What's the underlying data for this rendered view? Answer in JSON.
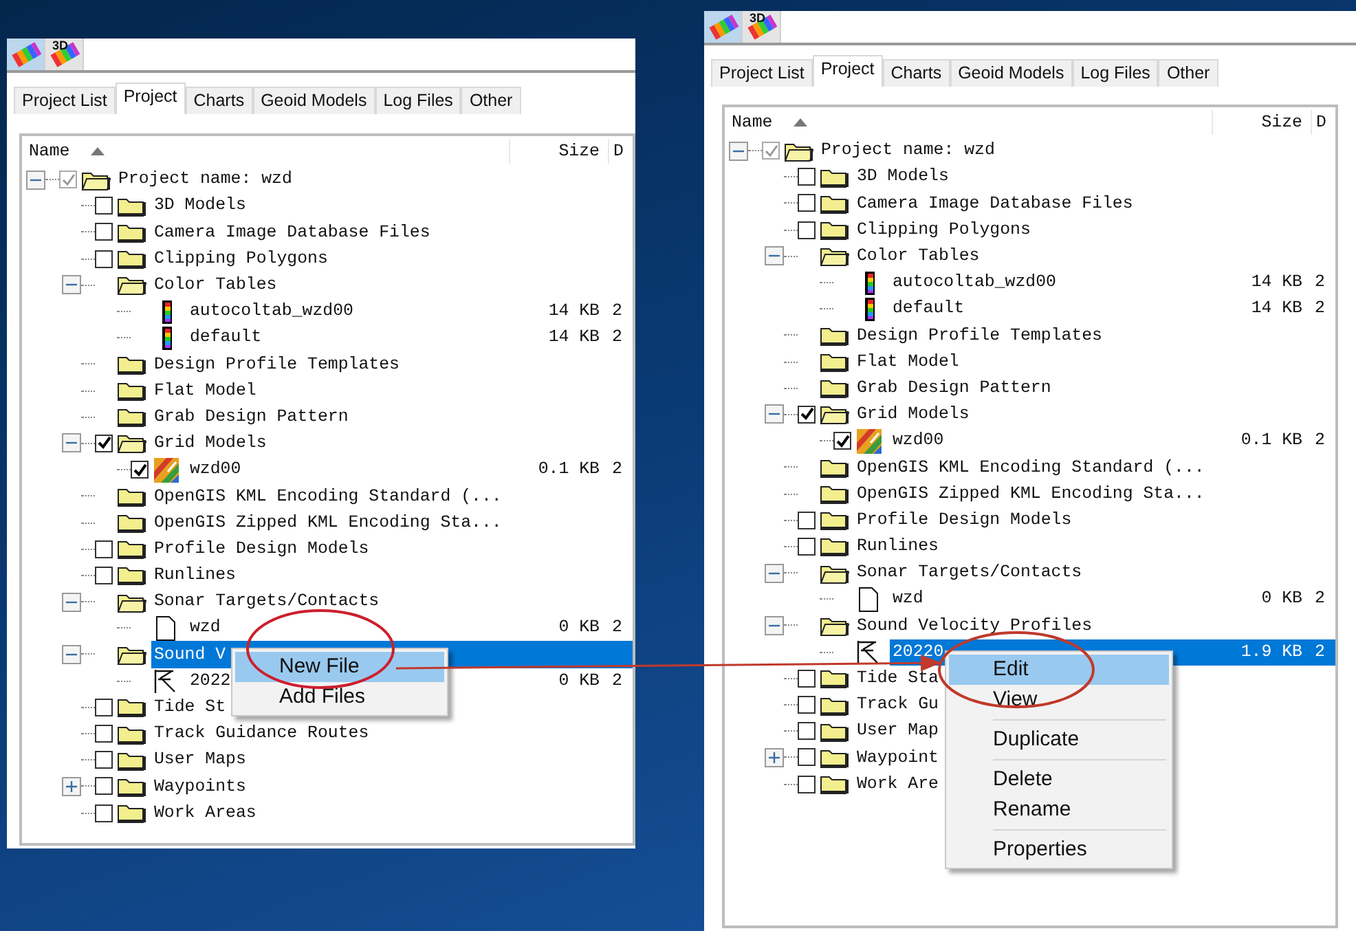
{
  "panels": [
    {
      "toolbar": [
        {
          "selected": true
        },
        {
          "selected": false,
          "label": "3D"
        }
      ],
      "tabs": [
        {
          "label": "Project List",
          "selected": false
        },
        {
          "label": "Project",
          "selected": true
        },
        {
          "label": "Charts",
          "selected": false
        },
        {
          "label": "Geoid Models",
          "selected": false
        },
        {
          "label": "Log Files",
          "selected": false
        },
        {
          "label": "Other",
          "selected": false
        }
      ],
      "columns": [
        {
          "label": "Name",
          "sort_ascending": true
        },
        {
          "label": "Size"
        },
        {
          "label": "D"
        }
      ],
      "tree": [
        {
          "label": "Project name: wzd",
          "kind": "folder",
          "expanded": true,
          "checked": true,
          "dimmed": true,
          "children": [
            {
              "label": "3D Models",
              "kind": "folder",
              "checked": false
            },
            {
              "label": "Camera Image Database Files",
              "kind": "folder",
              "checked": false
            },
            {
              "label": "Clipping Polygons",
              "kind": "folder",
              "checked": false
            },
            {
              "label": "Color Tables",
              "kind": "folder",
              "expanded": true,
              "children": [
                {
                  "label": "autocoltab_wzd00",
                  "kind": "colortable",
                  "size": "14 KB",
                  "date": "2"
                },
                {
                  "label": "default",
                  "kind": "colortable",
                  "size": "14 KB",
                  "date": "2"
                }
              ]
            },
            {
              "label": "Design Profile Templates",
              "kind": "folder"
            },
            {
              "label": "Flat Model",
              "kind": "folder"
            },
            {
              "label": "Grab Design Pattern",
              "kind": "folder"
            },
            {
              "label": "Grid Models",
              "kind": "folder",
              "expanded": true,
              "checked": true,
              "children": [
                {
                  "label": "wzd00",
                  "kind": "grid",
                  "checked": true,
                  "size": "0.1 KB",
                  "date": "2"
                }
              ]
            },
            {
              "label": "OpenGIS KML Encoding Standard (...",
              "kind": "folder"
            },
            {
              "label": "OpenGIS Zipped KML Encoding Sta...",
              "kind": "folder"
            },
            {
              "label": "Profile Design Models",
              "kind": "folder",
              "checked": false
            },
            {
              "label": "Runlines",
              "kind": "folder",
              "checked": false
            },
            {
              "label": "Sonar Targets/Contacts",
              "kind": "folder",
              "expanded": true,
              "children": [
                {
                  "label": "wzd",
                  "kind": "file",
                  "size": "0 KB",
                  "date": "2"
                }
              ]
            },
            {
              "label": "Sound V",
              "kind": "folder",
              "expanded": true,
              "selected": true,
              "children": [
                {
                  "label": "2022",
                  "kind": "profile",
                  "size": "0 KB",
                  "date": "2"
                }
              ]
            },
            {
              "label": "Tide St",
              "kind": "folder",
              "checked": false
            },
            {
              "label": "Track Guidance Routes",
              "kind": "folder",
              "checked": false
            },
            {
              "label": "User Maps",
              "kind": "folder",
              "checked": false
            },
            {
              "label": "Waypoints",
              "kind": "folder",
              "expanded": false,
              "checked": false
            },
            {
              "label": "Work Areas",
              "kind": "folder",
              "checked": false
            }
          ]
        }
      ],
      "context_menu": {
        "groups": [
          [
            {
              "label": "New File",
              "highlighted": true
            },
            {
              "label": "Add Files",
              "highlighted": false
            }
          ]
        ]
      }
    },
    {
      "toolbar": [
        {
          "selected": true
        },
        {
          "selected": false,
          "label": "3D"
        }
      ],
      "tabs": [
        {
          "label": "Project List",
          "selected": false
        },
        {
          "label": "Project",
          "selected": true
        },
        {
          "label": "Charts",
          "selected": false
        },
        {
          "label": "Geoid Models",
          "selected": false
        },
        {
          "label": "Log Files",
          "selected": false
        },
        {
          "label": "Other",
          "selected": false
        }
      ],
      "columns": [
        {
          "label": "Name",
          "sort_ascending": true
        },
        {
          "label": "Size"
        },
        {
          "label": "D"
        }
      ],
      "tree": [
        {
          "label": "Project name: wzd",
          "kind": "folder",
          "expanded": true,
          "checked": true,
          "dimmed": true,
          "children": [
            {
              "label": "3D Models",
              "kind": "folder",
              "checked": false
            },
            {
              "label": "Camera Image Database Files",
              "kind": "folder",
              "checked": false
            },
            {
              "label": "Clipping Polygons",
              "kind": "folder",
              "checked": false
            },
            {
              "label": "Color Tables",
              "kind": "folder",
              "expanded": true,
              "children": [
                {
                  "label": "autocoltab_wzd00",
                  "kind": "colortable",
                  "size": "14 KB",
                  "date": "2"
                },
                {
                  "label": "default",
                  "kind": "colortable",
                  "size": "14 KB",
                  "date": "2"
                }
              ]
            },
            {
              "label": "Design Profile Templates",
              "kind": "folder"
            },
            {
              "label": "Flat Model",
              "kind": "folder"
            },
            {
              "label": "Grab Design Pattern",
              "kind": "folder"
            },
            {
              "label": "Grid Models",
              "kind": "folder",
              "expanded": true,
              "checked": true,
              "children": [
                {
                  "label": "wzd00",
                  "kind": "grid",
                  "checked": true,
                  "size": "0.1 KB",
                  "date": "2"
                }
              ]
            },
            {
              "label": "OpenGIS KML Encoding Standard (...",
              "kind": "folder"
            },
            {
              "label": "OpenGIS Zipped KML Encoding Sta...",
              "kind": "folder"
            },
            {
              "label": "Profile Design Models",
              "kind": "folder",
              "checked": false
            },
            {
              "label": "Runlines",
              "kind": "folder",
              "checked": false
            },
            {
              "label": "Sonar Targets/Contacts",
              "kind": "folder",
              "expanded": true,
              "children": [
                {
                  "label": "wzd",
                  "kind": "file",
                  "size": "0 KB",
                  "date": "2"
                }
              ]
            },
            {
              "label": "Sound Velocity Profiles",
              "kind": "folder",
              "expanded": true,
              "children": [
                {
                  "label": "20220",
                  "kind": "profile",
                  "selected": true,
                  "size": "1.9 KB",
                  "date": "2"
                }
              ]
            },
            {
              "label": "Tide Sta",
              "kind": "folder",
              "checked": false
            },
            {
              "label": "Track Gu",
              "kind": "folder",
              "checked": false
            },
            {
              "label": "User Map",
              "kind": "folder",
              "checked": false
            },
            {
              "label": "Waypoint",
              "kind": "folder",
              "expanded": false,
              "checked": false
            },
            {
              "label": "Work Are",
              "kind": "folder",
              "checked": false
            }
          ]
        }
      ],
      "context_menu": {
        "groups": [
          [
            {
              "label": "Edit",
              "highlighted": true
            },
            {
              "label": "View",
              "highlighted": false
            }
          ],
          [
            {
              "label": "Duplicate",
              "highlighted": false
            }
          ],
          [
            {
              "label": "Delete",
              "highlighted": false
            },
            {
              "label": "Rename",
              "highlighted": false
            }
          ],
          [
            {
              "label": "Properties",
              "highlighted": false
            }
          ]
        ]
      }
    }
  ]
}
